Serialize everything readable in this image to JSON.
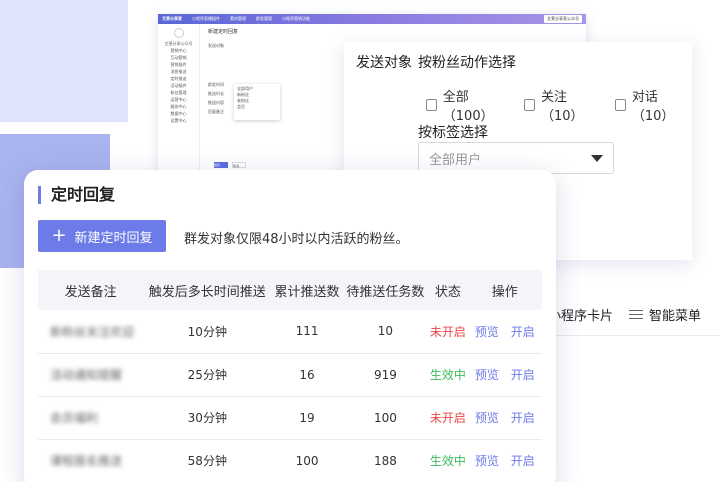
{
  "mini": {
    "logo": "艾莱分享家",
    "nav": [
      "小程序直播插件",
      "素材管理",
      "群发管理",
      "小程序营销功能"
    ],
    "tag": "艾莱分享家公众号",
    "sidebar": [
      "艾莱分享公众号",
      "营销中心",
      "互动营销",
      "营销插件",
      "消息推送",
      "定时推送",
      "活动插件",
      "粉丝管理",
      "运营中心",
      "服务中心",
      "数据中心",
      "设置中心"
    ],
    "title": "新建定时回复",
    "rows": [
      "发送对象",
      "群发时间",
      "推送时长",
      "推送内容",
      "回复备注"
    ],
    "dropdown": [
      "全部用户",
      "新粉丝",
      "老粉丝",
      "会员"
    ],
    "buttons": [
      "保存",
      "取消"
    ]
  },
  "target": {
    "label": "发送对象",
    "by_action": "按粉丝动作选择",
    "checks": [
      {
        "label": "全部（100）"
      },
      {
        "label": "关注（10）"
      },
      {
        "label": "对话（10）"
      }
    ],
    "by_tag": "按标签选择",
    "select_placeholder": "全部用户"
  },
  "strip": {
    "mini_card": "小程序卡片",
    "smart_menu": "智能菜单",
    "smart_menu_icon": "menu-lines-icon"
  },
  "card": {
    "title": "定时回复",
    "new_button": "新建定时回复",
    "new_button_icon": "plus-icon",
    "hint": "群发对象仅限48小时以内活跃的粉丝。",
    "headers": [
      "发送备注",
      "触发后多长时间推送",
      "累计推送数",
      "待推送任务数",
      "状态",
      "操作"
    ],
    "rows": [
      {
        "remark": "新粉丝关注欢迎",
        "delay": "10分钟",
        "total": "111",
        "pending": "10",
        "status": "未开启",
        "status_on": false,
        "action": "开启"
      },
      {
        "remark": "活动通知提醒",
        "delay": "25分钟",
        "total": "16",
        "pending": "919",
        "status": "生效中",
        "status_on": true,
        "action": "开启"
      },
      {
        "remark": "会员福利",
        "delay": "30分钟",
        "total": "19",
        "pending": "100",
        "status": "未开启",
        "status_on": false,
        "action": "开启"
      },
      {
        "remark": "课程报名推送",
        "delay": "58分钟",
        "total": "100",
        "pending": "188",
        "status": "生效中",
        "status_on": true,
        "action": "开启"
      }
    ],
    "preview_label": "预览"
  },
  "colors": {
    "accent": "#6c7be8",
    "status_off": "#e84848",
    "status_on": "#3dbb5a"
  }
}
